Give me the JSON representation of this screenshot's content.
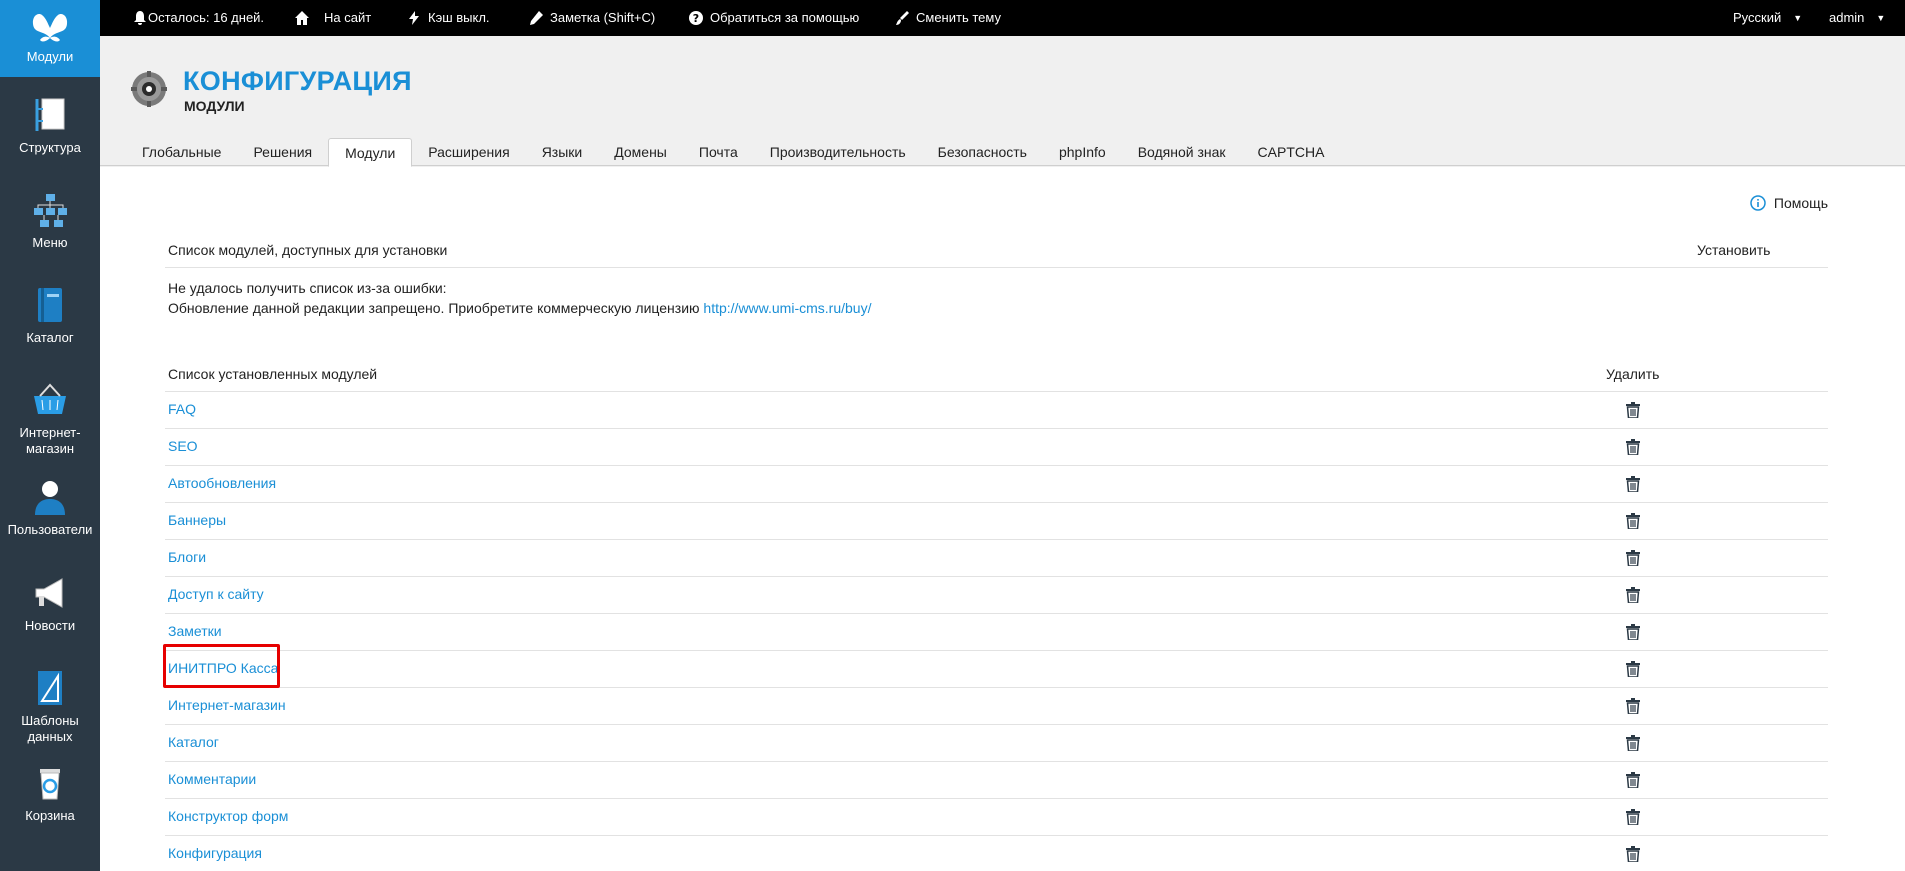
{
  "sidebar": {
    "items": [
      {
        "label": "Модули",
        "icon": "butterfly-icon"
      },
      {
        "label": "Структура",
        "icon": "structure-icon"
      },
      {
        "label": "Меню",
        "icon": "menu-tree-icon"
      },
      {
        "label": "Каталог",
        "icon": "catalog-book-icon"
      },
      {
        "label": "Интернет-магазин",
        "icon": "basket-icon"
      },
      {
        "label": "Пользователи",
        "icon": "user-icon"
      },
      {
        "label": "Новости",
        "icon": "megaphone-icon"
      },
      {
        "label": "Шаблоны данных",
        "icon": "template-icon"
      },
      {
        "label": "Корзина",
        "icon": "recycle-bin-icon"
      }
    ]
  },
  "topbar": {
    "trial": "Осталось: 16 дней.",
    "site": "На сайт",
    "cache": "Кэш выкл.",
    "note": "Заметка (Shift+C)",
    "help": "Обратиться за помощью",
    "theme": "Сменить тему",
    "language": "Русский",
    "user": "admin"
  },
  "header": {
    "title": "КОНФИГУРАЦИЯ",
    "subtitle": "МОДУЛИ",
    "tabs": [
      "Глобальные",
      "Решения",
      "Модули",
      "Расширения",
      "Языки",
      "Домены",
      "Почта",
      "Производительность",
      "Безопасность",
      "phpInfo",
      "Водяной знак",
      "CAPTCHA"
    ],
    "active_tab": "Модули"
  },
  "main": {
    "help": "Помощь",
    "available": {
      "title": "Список модулей, доступных для установки",
      "action": "Установить",
      "error_line1": "Не удалось получить список из-за ошибки:",
      "error_line2": "Обновление данной редакции запрещено. Приобретите коммерческую лицензию",
      "error_link": "http://www.umi-cms.ru/buy/"
    },
    "installed": {
      "title": "Список установленных модулей",
      "action": "Удалить",
      "modules": [
        "FAQ",
        "SEO",
        "Автообновления",
        "Баннеры",
        "Блоги",
        "Доступ к сайту",
        "Заметки",
        "ИНИТПРО Касса",
        "Интернет-магазин",
        "Каталог",
        "Комментарии",
        "Конструктор форм",
        "Конфигурация"
      ]
    }
  },
  "colors": {
    "accent": "#1a8fd6",
    "sidebar": "#2b3945",
    "topbar": "#000000",
    "highlight": "#e60000"
  }
}
